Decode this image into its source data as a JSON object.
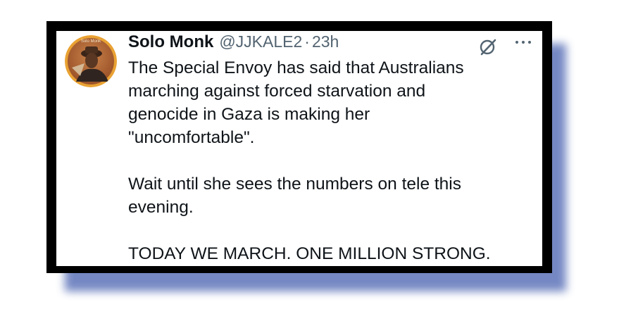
{
  "tweet": {
    "author_name": "Solo Monk",
    "handle": "@JJKALE2",
    "separator": "·",
    "time": "23h",
    "avatar_text": "Solo Monk",
    "icons": {
      "grok": "grok-slash-icon",
      "more": "more-dots-icon"
    },
    "paragraphs": [
      [
        "The Special Envoy has said that Australians",
        "marching against forced starvation and",
        "genocide in Gaza is making her",
        "\"uncomfortable\"."
      ],
      [
        "Wait until she sees the numbers on tele this",
        "evening."
      ],
      [
        "TODAY WE MARCH. ONE MILLION STRONG."
      ]
    ]
  },
  "colors": {
    "frame": "#000000",
    "shadow": "#5e74b9",
    "text": "#0f1419",
    "muted": "#536471",
    "avatar_ring": "#e9a233"
  }
}
